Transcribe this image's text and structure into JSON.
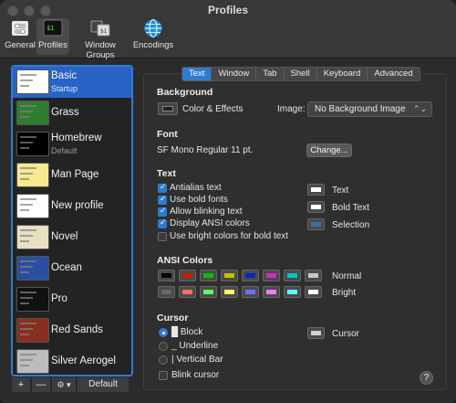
{
  "window": {
    "title": "Profiles"
  },
  "toolbar": {
    "items": [
      {
        "label": "General",
        "icon": "switch-icon"
      },
      {
        "label": "Profiles",
        "icon": "terminal-profile-icon"
      },
      {
        "label": "Window Groups",
        "icon": "window-groups-icon"
      },
      {
        "label": "Encodings",
        "icon": "globe-icon"
      }
    ]
  },
  "sidebar": {
    "profiles": [
      {
        "name": "Basic",
        "sub": "Startup",
        "thumb": "#ffffff",
        "selected": true
      },
      {
        "name": "Grass",
        "sub": "",
        "thumb": "#2f7d2f",
        "selected": false
      },
      {
        "name": "Homebrew",
        "sub": "Default",
        "thumb": "#000000",
        "selected": false
      },
      {
        "name": "Man Page",
        "sub": "",
        "thumb": "#f7e98e",
        "selected": false
      },
      {
        "name": "New profile",
        "sub": "",
        "thumb": "#ffffff",
        "selected": false
      },
      {
        "name": "Novel",
        "sub": "",
        "thumb": "#e9dfc3",
        "selected": false
      },
      {
        "name": "Ocean",
        "sub": "",
        "thumb": "#2a4fa1",
        "selected": false
      },
      {
        "name": "Pro",
        "sub": "",
        "thumb": "#111111",
        "selected": false
      },
      {
        "name": "Red Sands",
        "sub": "",
        "thumb": "#8a2e21",
        "selected": false
      },
      {
        "name": "Silver Aerogel",
        "sub": "",
        "thumb": "#bcbcbc",
        "selected": false
      }
    ],
    "bottom": {
      "add": "+",
      "remove": "—",
      "gear": "⚙ ▾",
      "default": "Default"
    }
  },
  "tabs": [
    "Text",
    "Window",
    "Tab",
    "Shell",
    "Keyboard",
    "Advanced"
  ],
  "background": {
    "heading": "Background",
    "color_effects": "Color & Effects",
    "image_label": "Image:",
    "image_value": "No Background Image"
  },
  "font": {
    "heading": "Font",
    "value": "SF Mono Regular 11 pt.",
    "change": "Change..."
  },
  "text": {
    "heading": "Text",
    "checkboxes": [
      {
        "label": "Antialias text",
        "checked": true
      },
      {
        "label": "Use bold fonts",
        "checked": true
      },
      {
        "label": "Allow blinking text",
        "checked": true
      },
      {
        "label": "Display ANSI colors",
        "checked": true
      },
      {
        "label": "Use bright colors for bold text",
        "checked": false
      }
    ],
    "colors": [
      {
        "label": "Text",
        "color": "#ffffff"
      },
      {
        "label": "Bold Text",
        "color": "#ffffff"
      },
      {
        "label": "Selection",
        "color": "#3a6ea5"
      }
    ]
  },
  "ansi": {
    "heading": "ANSI Colors",
    "normal_label": "Normal",
    "bright_label": "Bright",
    "normal": [
      "#000000",
      "#c91b00",
      "#00c200",
      "#c7c400",
      "#0225c7",
      "#c930c7",
      "#00c5c7",
      "#c7c7c7"
    ],
    "bright": [
      "#686868",
      "#ff6e67",
      "#5ffa68",
      "#fffc67",
      "#6871ff",
      "#ff77ff",
      "#60fdff",
      "#ffffff"
    ]
  },
  "cursor": {
    "heading": "Cursor",
    "options": [
      {
        "label": "Block",
        "glyph": "█",
        "selected": true
      },
      {
        "label": "Underline",
        "glyph": "_",
        "selected": false
      },
      {
        "label": "Vertical Bar",
        "glyph": "|",
        "selected": false
      }
    ],
    "blink": "Blink cursor",
    "cursor_color_label": "Cursor",
    "cursor_color": "#cfcfcf"
  },
  "help": "?"
}
